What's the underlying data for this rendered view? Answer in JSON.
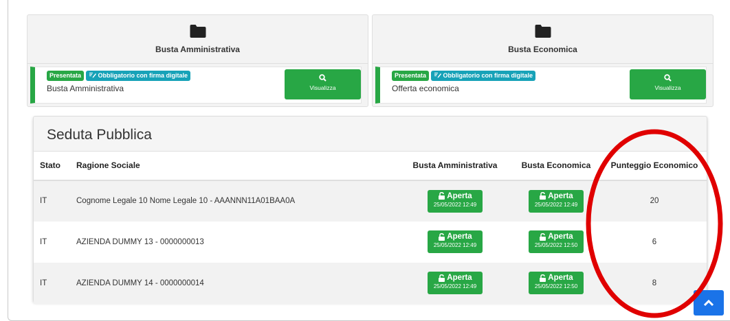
{
  "cards": [
    {
      "title": "Busta Amministrativa",
      "badge_status": "Presentata",
      "badge_required": "Obbligatorio con firma digitale",
      "doc_name": "Busta Amministrativa",
      "button": "Visualizza"
    },
    {
      "title": "Busta Economica",
      "badge_status": "Presentata",
      "badge_required": "Obbligatorio con firma digitale",
      "doc_name": "Offerta economica",
      "button": "Visualizza"
    }
  ],
  "seduta": {
    "title": "Seduta Pubblica",
    "headers": [
      "Stato",
      "Ragione Sociale",
      "Busta Amministrativa",
      "Busta Economica",
      "Punteggio Economico"
    ],
    "rows": [
      {
        "stato": "IT",
        "ragione": "Cognome Legale 10 Nome Legale 10 - AAANNN11A01BAA0A",
        "amm_label": "Aperta",
        "amm_date": "25/05/2022 12:49",
        "eco_label": "Aperta",
        "eco_date": "25/05/2022 12:49",
        "punteggio": "20"
      },
      {
        "stato": "IT",
        "ragione": "AZIENDA DUMMY 13 - 0000000013",
        "amm_label": "Aperta",
        "amm_date": "25/05/2022 12:49",
        "eco_label": "Aperta",
        "eco_date": "25/05/2022 12:50",
        "punteggio": "6"
      },
      {
        "stato": "IT",
        "ragione": "AZIENDA DUMMY 14 - 0000000014",
        "amm_label": "Aperta",
        "amm_date": "25/05/2022 12:49",
        "eco_label": "Aperta",
        "eco_date": "25/05/2022 12:50",
        "punteggio": "8"
      }
    ]
  },
  "colors": {
    "success": "#28a745",
    "info": "#17a2b8",
    "primary": "#1a73e8",
    "highlight": "#e00000"
  },
  "icons": [
    "folder-icon",
    "search-icon",
    "signature-icon",
    "unlock-icon",
    "chevron-up-icon"
  ]
}
